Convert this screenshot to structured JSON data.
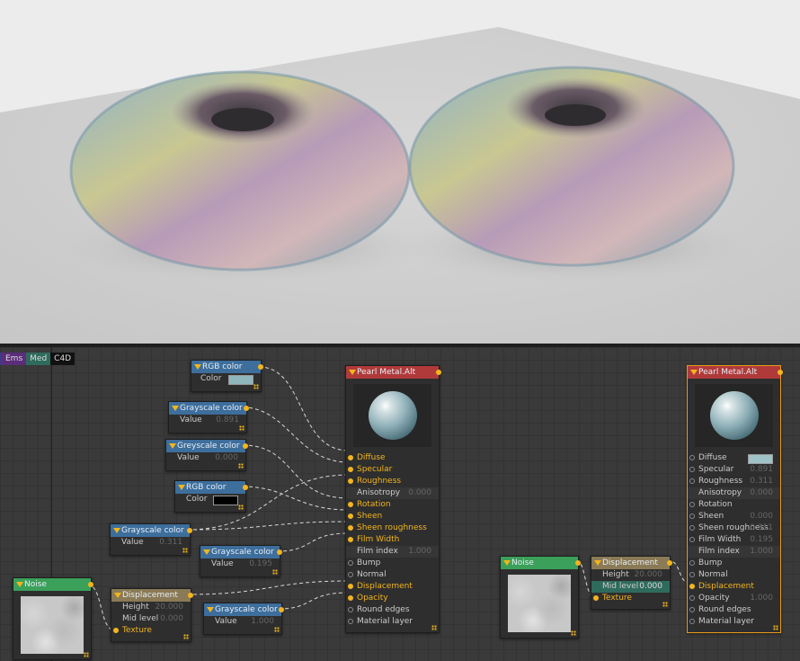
{
  "tabs": [
    {
      "label": "Ems",
      "color": "#5b2d7a"
    },
    {
      "label": "Med",
      "color": "#2f6b5c"
    },
    {
      "label": "C4D",
      "color": "#111111"
    }
  ],
  "nodes": {
    "rgb1": {
      "title": "RGB color",
      "label": "Color",
      "swatch": "#8fb6bc"
    },
    "gray1": {
      "title": "Grayscale color",
      "label": "Value",
      "value": "0.891"
    },
    "gray2": {
      "title": "Greyscale color",
      "label": "Value",
      "value": "0.000"
    },
    "rgb2": {
      "title": "RGB color",
      "label": "Color",
      "swatch": "#000000"
    },
    "gray3": {
      "title": "Grayscale color",
      "label": "Value",
      "value": "0.311"
    },
    "gray4": {
      "title": "Grayscale color",
      "label": "Value",
      "value": "0.195"
    },
    "gray5": {
      "title": "Grayscale color",
      "label": "Value",
      "value": "1.000"
    },
    "noise1": {
      "title": "Noise"
    },
    "disp1": {
      "title": "Displacement",
      "height_label": "Height",
      "height": "20.000",
      "mid_label": "Mid level",
      "mid": "0.000",
      "texture": "Texture"
    },
    "noise2": {
      "title": "Noise"
    },
    "disp2": {
      "title": "Displacement",
      "height_label": "Height",
      "height": "20.000",
      "mid_label": "Mid level",
      "mid": "0.000",
      "texture": "Texture"
    },
    "mat1": {
      "title": "Pearl Metal.Alt",
      "rows": [
        {
          "label": "Diffuse",
          "value": "",
          "connected": true
        },
        {
          "label": "Specular",
          "value": "",
          "connected": true
        },
        {
          "label": "Roughness",
          "value": "",
          "connected": true
        },
        {
          "label": "Anisotropy",
          "value": "0.000",
          "connected": false,
          "plain": true
        },
        {
          "label": "Rotation",
          "value": "",
          "connected": true
        },
        {
          "label": "Sheen",
          "value": "",
          "connected": true
        },
        {
          "label": "Sheen roughness",
          "value": "",
          "connected": true
        },
        {
          "label": "Film Width",
          "value": "",
          "connected": true
        },
        {
          "label": "Film index",
          "value": "1.000",
          "connected": false,
          "plain": true
        },
        {
          "label": "Bump",
          "value": "",
          "connected": false
        },
        {
          "label": "Normal",
          "value": "",
          "connected": false
        },
        {
          "label": "Displacement",
          "value": "",
          "connected": true
        },
        {
          "label": "Opacity",
          "value": "",
          "connected": true
        },
        {
          "label": "Round edges",
          "value": "",
          "connected": false
        },
        {
          "label": "Material layer",
          "value": "",
          "connected": false
        }
      ]
    },
    "mat2": {
      "title": "Pearl Metal.Alt",
      "rows": [
        {
          "label": "Diffuse",
          "value": "",
          "connected": false,
          "swatch": "#9fc3c8"
        },
        {
          "label": "Specular",
          "value": "0.891",
          "connected": false
        },
        {
          "label": "Roughness",
          "value": "0.311",
          "connected": false
        },
        {
          "label": "Anisotropy",
          "value": "0.000",
          "connected": false,
          "plain": true
        },
        {
          "label": "Rotation",
          "value": "",
          "connected": false
        },
        {
          "label": "Sheen",
          "value": "0.000",
          "connected": false
        },
        {
          "label": "Sheen roughness",
          "value": "0.311",
          "connected": false
        },
        {
          "label": "Film Width",
          "value": "0.195",
          "connected": false
        },
        {
          "label": "Film index",
          "value": "1.000",
          "connected": false,
          "plain": true
        },
        {
          "label": "Bump",
          "value": "",
          "connected": false
        },
        {
          "label": "Normal",
          "value": "",
          "connected": false
        },
        {
          "label": "Displacement",
          "value": "",
          "connected": true
        },
        {
          "label": "Opacity",
          "value": "1.000",
          "connected": false
        },
        {
          "label": "Round edges",
          "value": "",
          "connected": false
        },
        {
          "label": "Material layer",
          "value": "",
          "connected": false
        }
      ]
    }
  }
}
